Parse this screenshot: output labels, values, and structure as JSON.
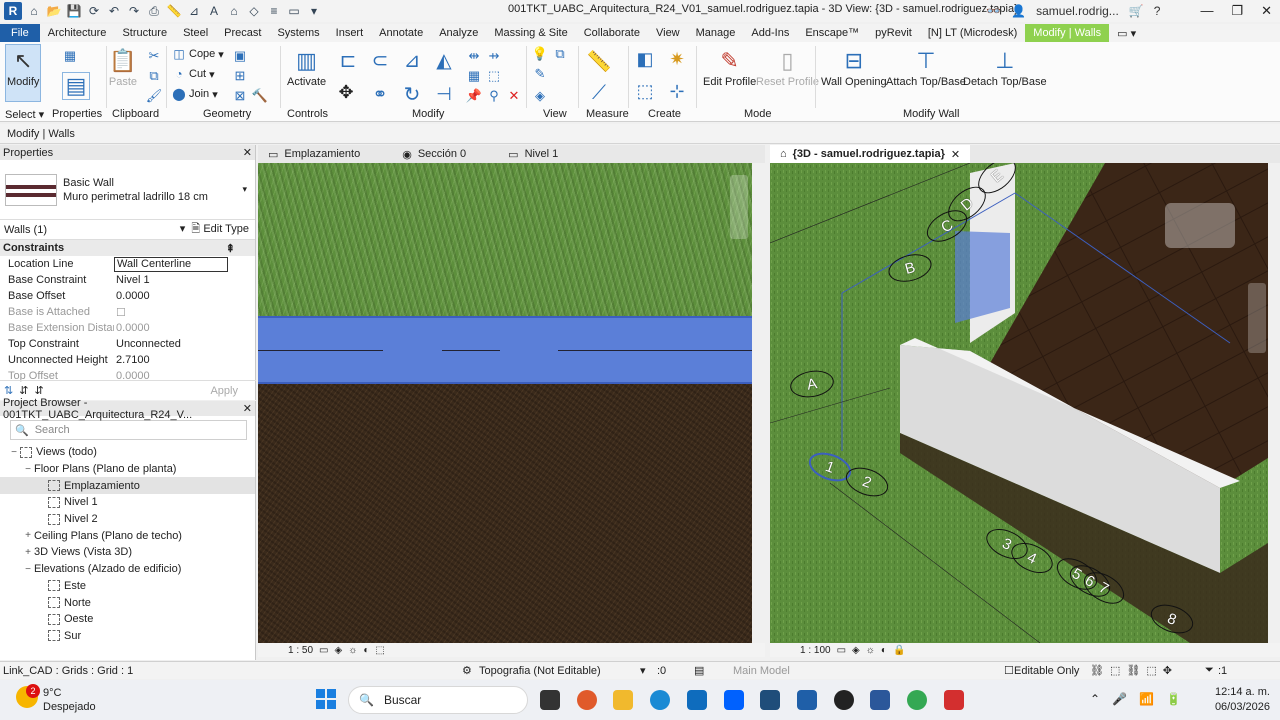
{
  "window": {
    "title": "001TKT_UABC_Arquitectura_R24_V01_samuel.rodriguez.tapia - 3D View: {3D - samuel.rodriguez.tapia}",
    "user": "samuel.rodrig...",
    "logo": "R"
  },
  "tabs": [
    "File",
    "Architecture",
    "Structure",
    "Steel",
    "Precast",
    "Systems",
    "Insert",
    "Annotate",
    "Analyze",
    "Massing & Site",
    "Collaborate",
    "View",
    "Manage",
    "Add-Ins",
    "Enscape™",
    "pyRevit",
    "[N] LT (Microdesk)",
    "Modify | Walls"
  ],
  "ribbon": {
    "modify": "Modify",
    "select": "Select",
    "properties": "Properties",
    "clipboard": "Clipboard",
    "paste": "Paste",
    "cope": "Cope",
    "cut": "Cut",
    "join": "Join",
    "geometry": "Geometry",
    "activate": "Activate",
    "controls": "Controls",
    "modify_panel": "Modify",
    "view": "View",
    "measure": "Measure",
    "create": "Create",
    "edit_profile": "Edit Profile",
    "reset_profile": "Reset Profile",
    "mode": "Mode",
    "wall_opening": "Wall Opening",
    "attach": "Attach Top/Base",
    "detach": "Detach Top/Base",
    "modify_wall": "Modify Wall"
  },
  "options_bar": "Modify | Walls",
  "properties": {
    "header": "Properties",
    "type_name": "Basic Wall",
    "type_sub": "Muro perimetral ladrillo 18 cm",
    "instance": "Walls (1)",
    "edit_type": "Edit Type",
    "group": "Constraints",
    "rows": [
      {
        "k": "Location Line",
        "v": "Wall Centerline"
      },
      {
        "k": "Base Constraint",
        "v": "Nivel 1"
      },
      {
        "k": "Base Offset",
        "v": "0.0000"
      },
      {
        "k": "Base is Attached",
        "v": ""
      },
      {
        "k": "Base Extension Distance",
        "v": "0.0000"
      },
      {
        "k": "Top Constraint",
        "v": "Unconnected"
      },
      {
        "k": "Unconnected Height",
        "v": "2.7100"
      },
      {
        "k": "Top Offset",
        "v": "0.0000"
      }
    ],
    "apply": "Apply"
  },
  "browser": {
    "header": "Project Browser - 001TKT_UABC_Arquitectura_R24_V...",
    "search_placeholder": "Search",
    "tree": [
      {
        "label": "Views (todo)",
        "level": 0,
        "exp": "−",
        "icon": true
      },
      {
        "label": "Floor Plans (Plano de planta)",
        "level": 1,
        "exp": "−"
      },
      {
        "label": "Emplazamiento",
        "level": 2,
        "icon": true,
        "hl": true
      },
      {
        "label": "Nivel 1",
        "level": 2,
        "icon": true
      },
      {
        "label": "Nivel 2",
        "level": 2,
        "icon": true
      },
      {
        "label": "Ceiling Plans (Plano de techo)",
        "level": 1,
        "exp": "+"
      },
      {
        "label": "3D Views (Vista 3D)",
        "level": 1,
        "exp": "+"
      },
      {
        "label": "Elevations (Alzado de edificio)",
        "level": 1,
        "exp": "−"
      },
      {
        "label": "Este",
        "level": 2,
        "icon": true
      },
      {
        "label": "Norte",
        "level": 2,
        "icon": true
      },
      {
        "label": "Oeste",
        "level": 2,
        "icon": true
      },
      {
        "label": "Sur",
        "level": 2,
        "icon": true
      }
    ]
  },
  "view_tabs_left": [
    "Emplazamiento",
    "Sección 0",
    "Nivel 1"
  ],
  "view_tab_right": "{3D - samuel.rodriguez.tapia}",
  "view_scale_left": "1 : 50",
  "view_scale_right": "1 : 100",
  "grids": [
    "A",
    "B",
    "C",
    "D",
    "E",
    "1",
    "2",
    "3",
    "4",
    "5",
    "6",
    "7",
    "8"
  ],
  "status": {
    "left": "Link_CAD : Grids : Grid : 1",
    "workset": "Topografia (Not Editable)",
    "zero": ":0",
    "model": "Main Model",
    "editable": "Editable Only",
    "filter": ":1"
  },
  "taskbar": {
    "temp": "9°C",
    "weather": "Despejado",
    "search": "Buscar",
    "time": "12:14 a. m.",
    "date": "06/03/2026",
    "badge": "2"
  },
  "colors": {
    "file_tab": "#1f5fa8",
    "modify_tab": "#8fd14f",
    "selection": "#5b7fd8"
  }
}
